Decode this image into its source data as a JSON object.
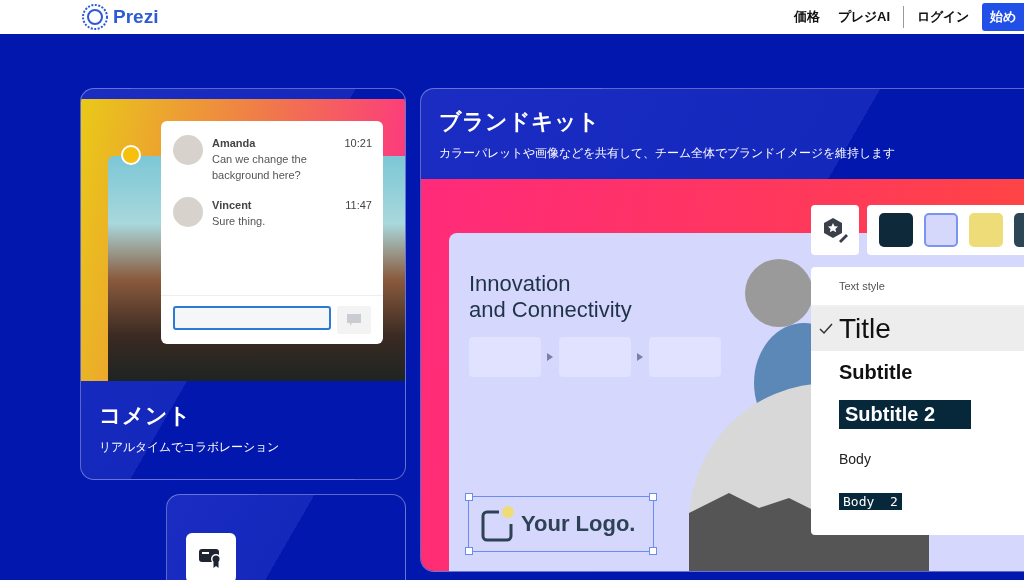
{
  "header": {
    "logo": "Prezi",
    "nav": [
      "価格",
      "プレジAI"
    ],
    "login": "ログイン",
    "cta": "始め"
  },
  "comment_card": {
    "title": "コメント",
    "subtitle": "リアルタイムでコラボレーション",
    "messages": [
      {
        "name": "Amanda",
        "text": "Can we change the background here?",
        "time": "10:21"
      },
      {
        "name": "Vincent",
        "text": "Sure thing.",
        "time": "11:47"
      }
    ]
  },
  "brand_card": {
    "title": "ブランドキット",
    "subtitle": "カラーパレットや画像などを共有して、チーム全体でブランドイメージを維持します",
    "slide": {
      "title": "Innovation\nand Connectivity",
      "logo": "Your Logo."
    },
    "swatches": [
      {
        "color": "#0e2a3a",
        "selected": false
      },
      {
        "color": "#d6d8fb",
        "selected": true
      },
      {
        "color": "#eedc78",
        "selected": false
      },
      {
        "color": "#2d4656",
        "selected": false
      }
    ],
    "text_style": {
      "heading": "Text style",
      "items": [
        {
          "kind": "title",
          "label": "Title",
          "selected": true
        },
        {
          "kind": "subtitle",
          "label": "Subtitle",
          "selected": false
        },
        {
          "kind": "subtitle2",
          "label": "Subtitle 2",
          "selected": false
        },
        {
          "kind": "body",
          "label": "Body",
          "selected": false
        },
        {
          "kind": "body2",
          "label": "Body  2",
          "selected": false
        }
      ]
    }
  }
}
